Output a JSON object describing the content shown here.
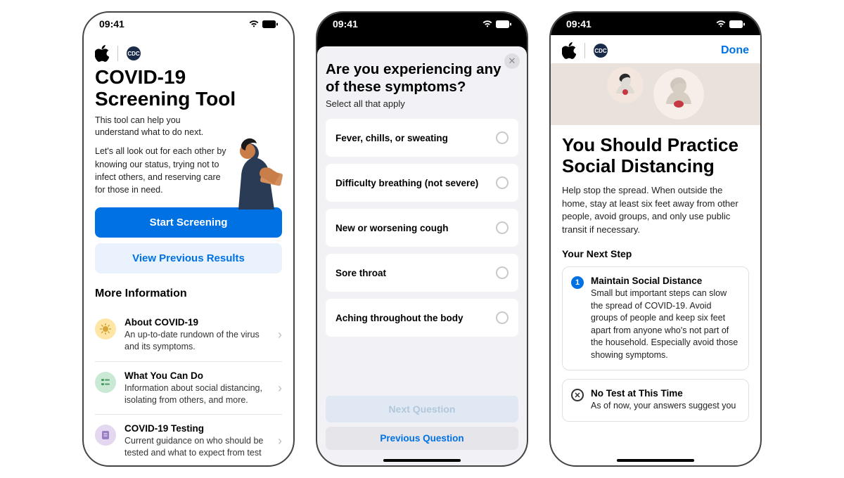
{
  "status": {
    "time": "09:41"
  },
  "screen1": {
    "title": "COVID-19 Screening Tool",
    "subtitle": "This tool can help you understand what to do next.",
    "paragraph": "Let's all look out for each other by knowing our status, trying not to infect others, and reserving care for those in need.",
    "btn_start": "Start Screening",
    "btn_prev": "View Previous Results",
    "more_info": "More Information",
    "items": [
      {
        "title": "About COVID-19",
        "desc": "An up-to-date rundown of the virus and its symptoms."
      },
      {
        "title": "What You Can Do",
        "desc": "Information about social distancing, isolating from others, and more."
      },
      {
        "title": "COVID-19 Testing",
        "desc": "Current guidance on who should be tested and what to expect from test"
      }
    ]
  },
  "screen2": {
    "question": "Are you experiencing any of these symptoms?",
    "instruction": "Select all that apply",
    "options": [
      "Fever, chills, or sweating",
      "Difficulty breathing (not severe)",
      "New or worsening cough",
      "Sore throat",
      "Aching throughout the body"
    ],
    "btn_next": "Next Question",
    "btn_prev": "Previous Question"
  },
  "screen3": {
    "done": "Done",
    "title": "You Should Practice Social Distancing",
    "paragraph": "Help stop the spread. When outside the home, stay at least six feet away from other people, avoid groups, and only use public transit if necessary.",
    "next_step_h": "Your Next Step",
    "step1_title": "Maintain Social Distance",
    "step1_body": "Small but important steps can slow the spread of COVID-19. Avoid groups of people and keep six feet apart from anyone who's not part of the household. Especially avoid those showing symptoms.",
    "step2_title": "No Test at This Time",
    "step2_body": "As of now, your answers suggest you"
  }
}
